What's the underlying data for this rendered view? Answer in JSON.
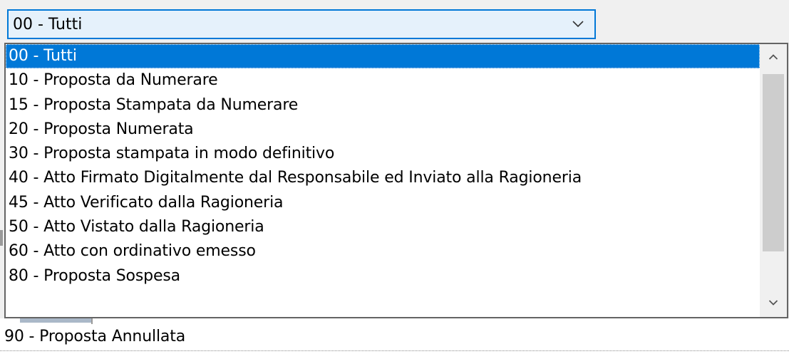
{
  "combo": {
    "value": "00 - Tutti",
    "arrow_icon": "chevron-down-icon"
  },
  "dropdown": {
    "selected_index": 0,
    "options": [
      "00 - Tutti",
      "10 - Proposta da Numerare",
      "15 - Proposta Stampata da Numerare",
      "20 - Proposta Numerata",
      "30 - Proposta stampata in modo definitivo",
      "40 - Atto Firmato Digitalmente dal Responsabile ed Inviato alla Ragioneria",
      "45 - Atto Verificato dalla Ragioneria",
      "50 - Atto Vistato dalla Ragioneria",
      "60 - Atto con ordinativo emesso",
      "80 - Proposta Sospesa"
    ],
    "scroll_up_icon": "chevron-up-icon",
    "scroll_down_icon": "chevron-down-icon"
  },
  "below_list": {
    "text": "90 - Proposta Annullata"
  },
  "colors": {
    "selection": "#0078d7",
    "combo_background": "#e5f1fb",
    "scroll_thumb": "#cdcdcd",
    "window_background": "#f0f0f0"
  }
}
